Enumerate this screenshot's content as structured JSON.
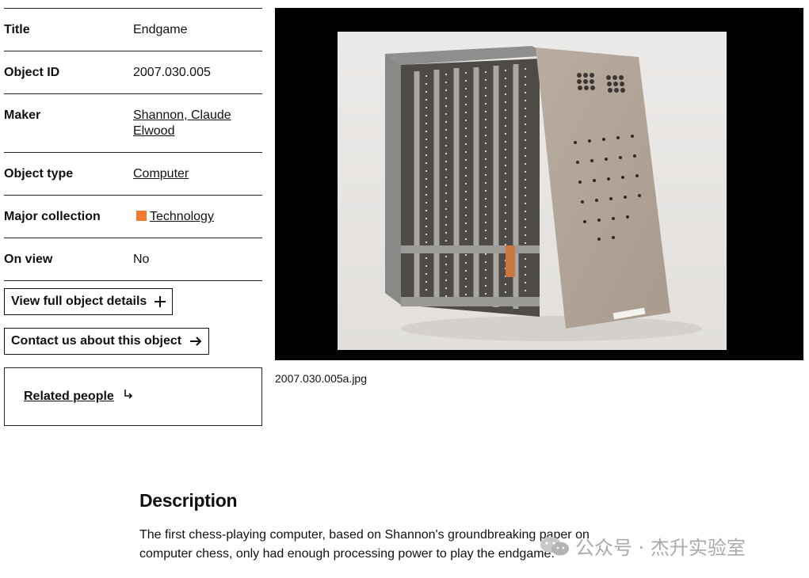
{
  "details": [
    {
      "label": "Title",
      "value": "Endgame",
      "link": false
    },
    {
      "label": "Object ID",
      "value": "2007.030.005",
      "link": false
    },
    {
      "label": "Maker",
      "value": "Shannon, Claude Elwood",
      "link": true
    },
    {
      "label": "Object type",
      "value": "Computer",
      "link": true
    },
    {
      "label": "Major collection",
      "value": "Technology",
      "link": true,
      "swatch_color": "#f37b2f"
    },
    {
      "label": "On view",
      "value": "No",
      "link": false
    }
  ],
  "buttons": {
    "view_details": "View full object details",
    "contact": "Contact us about this object"
  },
  "related": {
    "label": "Related people"
  },
  "image": {
    "caption": "2007.030.005a.jpg"
  },
  "description": {
    "title": "Description",
    "text": "The first chess-playing computer, based on Shannon's groundbreaking paper on computer chess, only had enough processing power to play the endgame."
  },
  "watermark": {
    "text": "公众号 · 杰升实验室"
  },
  "colors": {
    "accent": "#f37b2f",
    "image_bg": "#000000"
  }
}
